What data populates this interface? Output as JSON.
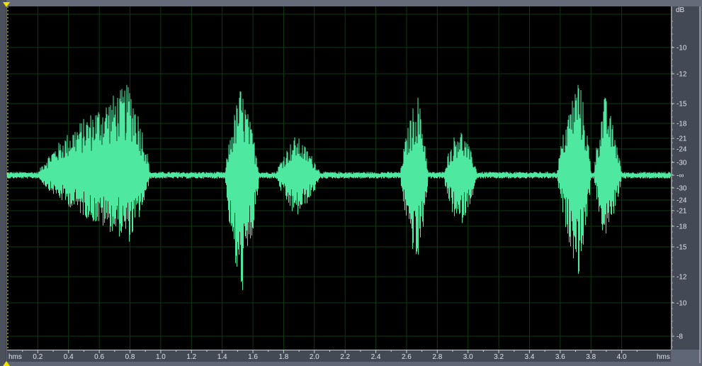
{
  "chart_data": {
    "type": "line",
    "title": "",
    "xlabel": "hms",
    "ylabel": "dB",
    "xlim": [
      0,
      4.32
    ],
    "x_ticks": [
      "0.2",
      "0.4",
      "0.6",
      "0.8",
      "1.0",
      "1.2",
      "1.4",
      "1.6",
      "1.8",
      "2.0",
      "2.2",
      "2.4",
      "2.6",
      "2.8",
      "3.0",
      "3.2",
      "3.4",
      "3.6",
      "3.8",
      "4.0"
    ],
    "x_unit_labels": [
      "hms",
      "hms"
    ],
    "y_unit_label": "dB",
    "y_ticks_upper": [
      "-10",
      "-12",
      "-15",
      "-18",
      "-21",
      "-24",
      "-30",
      "-∞"
    ],
    "y_ticks_lower": [
      "-30",
      "-24",
      "-21",
      "-18",
      "-15",
      "-12",
      "-10",
      "-8"
    ],
    "grid": true,
    "waveform_color": "#4ee8a0",
    "grid_color": "#0f3a0f",
    "noise_floor": 0.02,
    "bursts": [
      {
        "start": 0.2,
        "end": 0.93,
        "peak_pos": 0.55,
        "peak_neg": 0.4,
        "center": 0.8
      },
      {
        "start": 1.42,
        "end": 1.64,
        "peak_pos": 0.53,
        "peak_neg": 0.75,
        "center": 1.52
      },
      {
        "start": 1.75,
        "end": 2.04,
        "peak_pos": 0.24,
        "peak_neg": 0.26,
        "center": 1.88
      },
      {
        "start": 2.56,
        "end": 2.74,
        "peak_pos": 0.5,
        "peak_neg": 0.56,
        "center": 2.67
      },
      {
        "start": 2.84,
        "end": 3.06,
        "peak_pos": 0.3,
        "peak_neg": 0.33,
        "center": 2.94
      },
      {
        "start": 3.58,
        "end": 3.8,
        "peak_pos": 0.6,
        "peak_neg": 0.6,
        "center": 3.72
      },
      {
        "start": 3.82,
        "end": 4.0,
        "peak_pos": 0.48,
        "peak_neg": 0.4,
        "center": 3.89
      }
    ]
  }
}
